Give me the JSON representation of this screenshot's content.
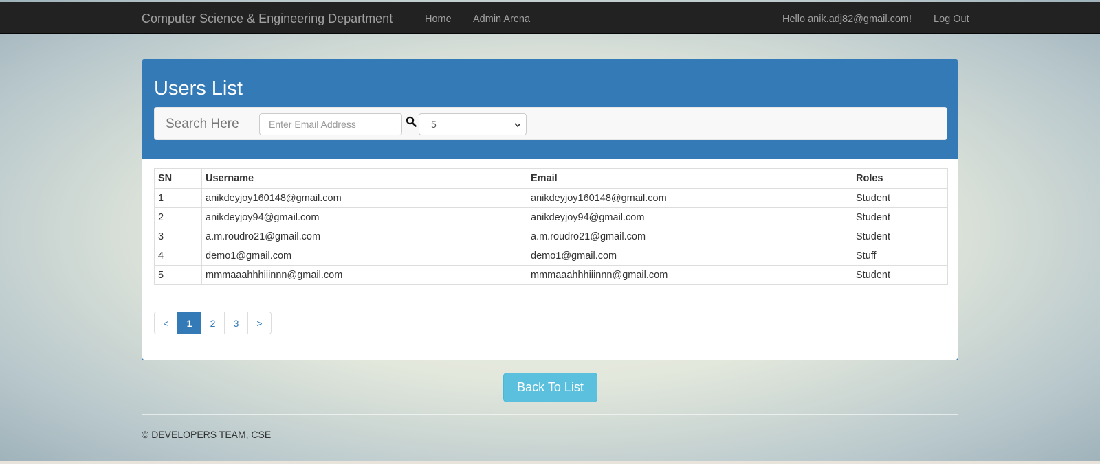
{
  "navbar": {
    "brand": "Computer Science & Engineering Department",
    "links": {
      "home": "Home",
      "admin": "Admin Arena"
    },
    "greeting": "Hello anik.adj82@gmail.com!",
    "logout": "Log Out"
  },
  "panel": {
    "title": "Users List",
    "search": {
      "label": "Search Here",
      "placeholder": "Enter Email Address",
      "value": ""
    },
    "page_size": "5"
  },
  "table": {
    "headers": {
      "sn": "SN",
      "username": "Username",
      "email": "Email",
      "roles": "Roles"
    },
    "rows": [
      {
        "sn": "1",
        "username": "anikdeyjoy160148@gmail.com",
        "email": "anikdeyjoy160148@gmail.com",
        "role": "Student"
      },
      {
        "sn": "2",
        "username": "anikdeyjoy94@gmail.com",
        "email": "anikdeyjoy94@gmail.com",
        "role": "Student"
      },
      {
        "sn": "3",
        "username": "a.m.roudro21@gmail.com",
        "email": "a.m.roudro21@gmail.com",
        "role": "Student"
      },
      {
        "sn": "4",
        "username": "demo1@gmail.com",
        "email": "demo1@gmail.com",
        "role": "Stuff"
      },
      {
        "sn": "5",
        "username": "mmmaaahhhiiinnn@gmail.com",
        "email": "mmmaaahhhiiinnn@gmail.com",
        "role": "Student"
      }
    ]
  },
  "pagination": {
    "prev": "<",
    "pages": [
      "1",
      "2",
      "3"
    ],
    "next": ">",
    "active": "1"
  },
  "actions": {
    "back_label": "Back To List"
  },
  "footer": {
    "text": "© DEVELOPERS TEAM, CSE"
  },
  "colors": {
    "navbar": "#222222",
    "primary": "#337ab7",
    "info_button": "#5bc0de"
  }
}
